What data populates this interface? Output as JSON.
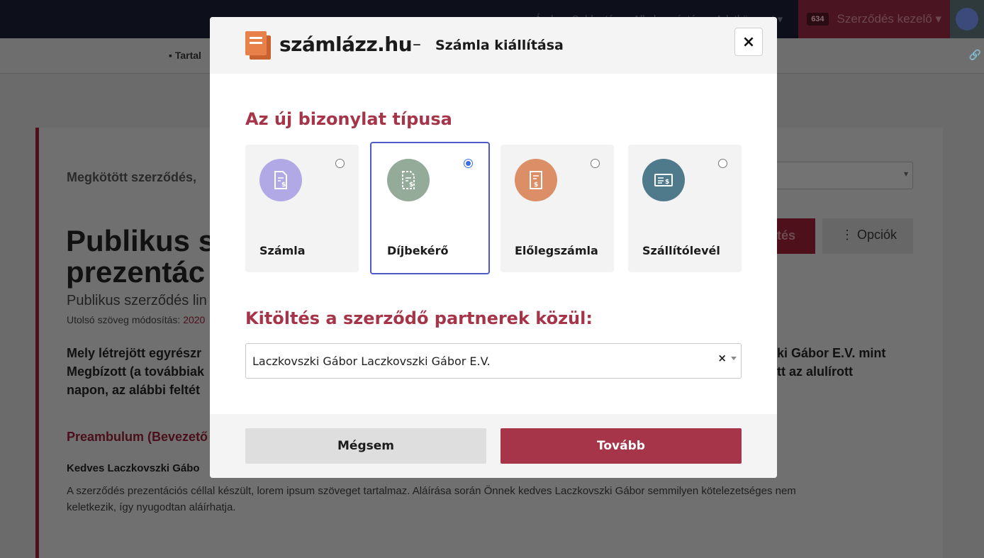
{
  "background": {
    "topnav": {
      "links": [
        "Árak",
        "Sablontár",
        "Alkalmazástár"
      ],
      "dropdown": "Adatközpont",
      "badge": "634",
      "contract_manager": "Szerződés kezelő"
    },
    "subbar_tab": "Tartal",
    "contract_status": "Megkötött szerződés,",
    "title_line1": "Publikus s",
    "title_line2": "prezentác",
    "subtitle": "Publikus szerződés lin",
    "last_modified_label": "Utolsó szöveg módosítás:",
    "last_modified_value": "2020",
    "intro_left": [
      "Mely létrejött egyrészr",
      "Megbízott (a továbbiak",
      "napon, az alábbi feltét"
    ],
    "intro_right": [
      "ki Gábor E.V. mint",
      "tt az alulírott"
    ],
    "preamble_heading": "Preambulum (Bevezető",
    "greeting": "Kedves Laczkovszki Gábo",
    "paragraph_line1": "A szerződés prezentációs céllal készült, lorem ipsum szöveget tartalmaz. Aláírása során Önnek kedves Laczkovszki Gábor semmilyen kötelezetséges nem",
    "paragraph_line2": "keletkezik, így nyugodtan aláírhatja.",
    "red_button": "ltés",
    "options_button": "Opciók"
  },
  "modal": {
    "logo_text": "számlázz.hu",
    "separator": "–",
    "title": "Számla kiállítása",
    "close_label": "×",
    "section1_title": "Az új bizonylat típusa",
    "doc_types": [
      {
        "label": "Számla",
        "icon": "invoice-icon",
        "color": "#b0a9e6",
        "selected": false
      },
      {
        "label": "Díjbekérő",
        "icon": "payment-request-icon",
        "color": "#93ab98",
        "selected": true
      },
      {
        "label": "Előlegszámla",
        "icon": "advance-invoice-icon",
        "color": "#dc8e67",
        "selected": false
      },
      {
        "label": "Szállítólevél",
        "icon": "delivery-note-icon",
        "color": "#4f7a8c",
        "selected": false
      }
    ],
    "section2_title": "Kitöltés a szerződő partnerek közül:",
    "partner_value": "Laczkovszki Gábor Laczkovszki Gábor E.V.",
    "clear_label": "×",
    "cancel_label": "Mégsem",
    "next_label": "Tovább"
  },
  "colors": {
    "accent": "#a6354a",
    "selected_border": "#5059c9",
    "logo_orange": "#e8804a"
  }
}
